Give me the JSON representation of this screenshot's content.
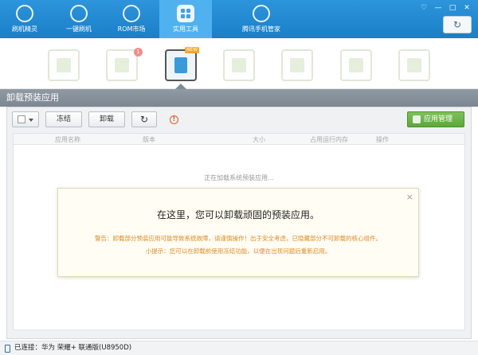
{
  "nav": {
    "tabs": [
      {
        "label": "刷机精灵",
        "icon": "logo-s-icon"
      },
      {
        "label": "一键刷机",
        "icon": "cursor-icon"
      },
      {
        "label": "ROM市场",
        "icon": "android-icon"
      },
      {
        "label": "实用工具",
        "icon": "grid-tools-icon",
        "active": true
      },
      {
        "label": "腾讯手机管家",
        "icon": "shield-icon"
      }
    ],
    "window_controls": [
      "♡",
      "—",
      "□",
      "✕"
    ],
    "refresh_glyph": "↻"
  },
  "tools": {
    "badge_count": "1",
    "new_badge": "NEW"
  },
  "section": {
    "title": "卸载预装应用"
  },
  "toolbar": {
    "freeze_label": "冻结",
    "uninstall_label": "卸载",
    "refresh_glyph": "↻",
    "warn_glyph": "!",
    "app_manager_label": "应用管理"
  },
  "table": {
    "columns": [
      "应用名称",
      "版本",
      "大小",
      "占用运行内存",
      "操作"
    ],
    "loading_text": "正在加载系统预装应用..."
  },
  "modal": {
    "close_glyph": "×",
    "title": "在这里，您可以卸载顽固的预装应用。",
    "warning": "警告：卸载部分预装应用可能导致系统故障，请谨慎操作！出于安全考虑，已隐藏部分不可卸载的核心组件。",
    "tip": "小提示：您可以在卸载前使用冻结功能，以便在出现问题后重新启用。"
  },
  "status": {
    "text": "已连接：华为 荣耀+ 联通版(U8950D)"
  },
  "colors": {
    "accent": "#1a7fc8",
    "active_tab": "#4fb2ef",
    "app_manager": "#5da83b",
    "warning_text": "#e08a2a"
  }
}
